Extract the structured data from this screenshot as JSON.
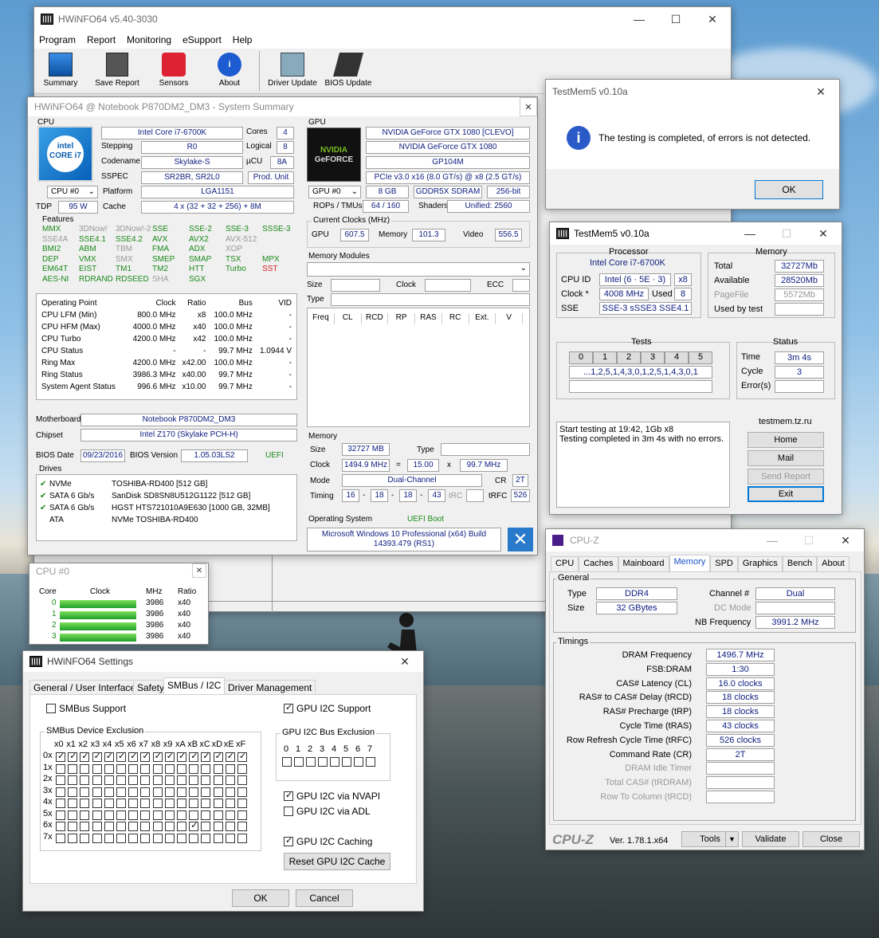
{
  "hw_main": {
    "title": "HWiNFO64 v5.40-3030",
    "menu": [
      "Program",
      "Report",
      "Monitoring",
      "eSupport",
      "Help"
    ],
    "toolbar": [
      "Summary",
      "Save Report",
      "Sensors",
      "About",
      "Driver Update",
      "BIOS Update"
    ]
  },
  "summary": {
    "title": "HWiNFO64 @ Notebook P870DM2_DM3 - System Summary",
    "cpu": {
      "section": "CPU",
      "name": "Intel Core i7-6700K",
      "cores_l": "Cores",
      "cores": "4",
      "stepping_l": "Stepping",
      "stepping": "R0",
      "logical_l": "Logical",
      "logical": "8",
      "codename_l": "Codename",
      "codename": "Skylake-S",
      "ucu_l": "µCU",
      "ucu": "8A",
      "sspec_l": "SSPEC",
      "sspec": "SR2BR, SR2L0",
      "produnit": "Prod. Unit",
      "cpu_sel": "CPU #0",
      "platform_l": "Platform",
      "platform": "LGA1151",
      "tdp_l": "TDP",
      "tdp": "95 W",
      "cache_l": "Cache",
      "cache": "4 x (32 + 32 + 256) + 8M",
      "features_l": "Features",
      "features": [
        [
          "MMX",
          "g"
        ],
        [
          "3DNow!",
          "x"
        ],
        [
          "3DNow!-2",
          "x"
        ],
        [
          "SSE",
          "g"
        ],
        [
          "SSE-2",
          "g"
        ],
        [
          "SSE-3",
          "g"
        ],
        [
          "SSSE-3",
          "g"
        ],
        [
          "SSE4A",
          "x"
        ],
        [
          "SSE4.1",
          "g"
        ],
        [
          "SSE4.2",
          "g"
        ],
        [
          "AVX",
          "g"
        ],
        [
          "AVX2",
          "g"
        ],
        [
          "AVX-512",
          "x"
        ],
        [
          "",
          ""
        ],
        [
          "BMI2",
          "g"
        ],
        [
          "ABM",
          "g"
        ],
        [
          "TBM",
          "x"
        ],
        [
          "FMA",
          "g"
        ],
        [
          "ADX",
          "g"
        ],
        [
          "XOP",
          "x"
        ],
        [
          "",
          ""
        ],
        [
          "DEP",
          "g"
        ],
        [
          "VMX",
          "g"
        ],
        [
          "SMX",
          "x"
        ],
        [
          "SMEP",
          "g"
        ],
        [
          "SMAP",
          "g"
        ],
        [
          "TSX",
          "g"
        ],
        [
          "MPX",
          "g"
        ],
        [
          "EM64T",
          "g"
        ],
        [
          "EIST",
          "g"
        ],
        [
          "TM1",
          "g"
        ],
        [
          "TM2",
          "g"
        ],
        [
          "HTT",
          "g"
        ],
        [
          "Turbo",
          "g"
        ],
        [
          "SST",
          "r"
        ],
        [
          "AES-NI",
          "g"
        ],
        [
          "RDRAND",
          "g"
        ],
        [
          "RDSEED",
          "g"
        ],
        [
          "SHA",
          "x"
        ],
        [
          "SGX",
          "g"
        ]
      ],
      "op_headers": [
        "Operating Point",
        "Clock",
        "Ratio",
        "Bus",
        "VID"
      ],
      "op_rows": [
        [
          "CPU LFM (Min)",
          "800.0 MHz",
          "x8",
          "100.0 MHz",
          "-"
        ],
        [
          "CPU HFM (Max)",
          "4000.0 MHz",
          "x40",
          "100.0 MHz",
          "-"
        ],
        [
          "CPU Turbo",
          "4200.0 MHz",
          "x42",
          "100.0 MHz",
          "-"
        ],
        [
          "CPU Status",
          "-",
          "-",
          "99.7 MHz",
          "1.0944 V"
        ],
        [
          "Ring Max",
          "4200.0 MHz",
          "x42.00",
          "100.0 MHz",
          "-"
        ],
        [
          "Ring Status",
          "3986.3 MHz",
          "x40.00",
          "99.7 MHz",
          "-"
        ],
        [
          "System Agent Status",
          "996.6 MHz",
          "x10.00",
          "99.7 MHz",
          "-"
        ]
      ]
    },
    "mb": {
      "mb_l": "Motherboard",
      "mb": "Notebook P870DM2_DM3",
      "chipset_l": "Chipset",
      "chipset": "Intel Z170 (Skylake PCH-H)",
      "biosdate_l": "BIOS Date",
      "biosdate": "09/23/2016",
      "biosver_l": "BIOS Version",
      "biosver": "1.05.03LS2",
      "uefi": "UEFI"
    },
    "drives": {
      "label": "Drives",
      "rows": [
        [
          "NVMe",
          "TOSHIBA-RD400 [512 GB]",
          true
        ],
        [
          "SATA 6 Gb/s",
          "SanDisk SD8SN8U512G1122 [512 GB]",
          true
        ],
        [
          "SATA 6 Gb/s",
          "HGST HTS721010A9E630 [1000 GB, 32MB]",
          true
        ],
        [
          "ATA",
          "NVMe TOSHIBA-RD400",
          false
        ]
      ]
    },
    "gpu": {
      "section": "GPU",
      "name1": "NVIDIA GeForce GTX 1080 [CLEVO]",
      "name2": "NVIDIA GeForce GTX 1080",
      "chip": "GP104M",
      "bus": "PCIe v3.0 x16 (8.0 GT/s) @ x8 (2.5 GT/s)",
      "gpu_sel": "GPU #0",
      "vram": "8 GB",
      "memtype": "GDDR5X SDRAM",
      "width": "256-bit",
      "rops_l": "ROPs / TMUs",
      "rops": "64 / 160",
      "shaders_l": "Shaders",
      "shaders": "Unified: 2560",
      "clocks_l": "Current Clocks (MHz)",
      "gpu_l": "GPU",
      "gpu_clk": "607.5",
      "mem_l": "Memory",
      "mem_clk": "101.3",
      "video_l": "Video",
      "video_clk": "556.5"
    },
    "modules": {
      "label": "Memory Modules",
      "size_l": "Size",
      "clock_l": "Clock",
      "ecc_l": "ECC",
      "type_l": "Type",
      "cols": [
        "Freq",
        "CL",
        "RCD",
        "RP",
        "RAS",
        "RC",
        "Ext.",
        "V"
      ]
    },
    "memory": {
      "label": "Memory",
      "size_l": "Size",
      "size": "32727 MB",
      "type_l": "Type",
      "clock_l": "Clock",
      "clock": "1494.9 MHz",
      "eq": "=",
      "mult": "15.00",
      "x": "x",
      "base": "99.7 MHz",
      "mode_l": "Mode",
      "mode": "Dual-Channel",
      "cr_l": "CR",
      "cr": "2T",
      "timing_l": "Timing",
      "t1": "16",
      "t2": "18",
      "t3": "18",
      "t4": "43",
      "trc": "tRC",
      "trfc_l": "tRFC",
      "trfc": "526"
    },
    "os": {
      "label": "Operating System",
      "boot": "UEFI Boot",
      "name": "Microsoft Windows 10 Professional (x64) Build 14393.479 (RS1)"
    }
  },
  "cpu0": {
    "title": "CPU #0",
    "headers": [
      "Core",
      "Clock",
      "MHz",
      "Ratio"
    ],
    "rows": [
      [
        "0",
        "3986",
        "x40"
      ],
      [
        "1",
        "3986",
        "x40"
      ],
      [
        "2",
        "3986",
        "x40"
      ],
      [
        "3",
        "3986",
        "x40"
      ]
    ],
    "fill": 1.0
  },
  "settings": {
    "title": "HWiNFO64 Settings",
    "tabs": [
      "General / User Interface",
      "Safety",
      "SMBus / I2C",
      "Driver Management"
    ],
    "smbus_support": "SMBus Support",
    "gpu_i2c": "GPU I2C Support",
    "excl_label": "SMBus Device Exclusion",
    "cols": [
      "x0",
      "x1",
      "x2",
      "x3",
      "x4",
      "x5",
      "x6",
      "x7",
      "x8",
      "x9",
      "xA",
      "xB",
      "xC",
      "xD",
      "xE",
      "xF"
    ],
    "rows": [
      "0x",
      "1x",
      "2x",
      "3x",
      "4x",
      "5x",
      "6x",
      "7x"
    ],
    "bus_label": "GPU I2C Bus Exclusion",
    "bus_cols": [
      "0",
      "1",
      "2",
      "3",
      "4",
      "5",
      "6",
      "7"
    ],
    "nvapi": "GPU I2C via NVAPI",
    "adl": "GPU I2C via ADL",
    "caching": "GPU I2C Caching",
    "reset": "Reset GPU I2C Cache",
    "ok": "OK",
    "cancel": "Cancel"
  },
  "tm_dialog": {
    "title": "TestMem5 v0.10a",
    "message": "The testing is completed, of errors is not detected.",
    "ok": "OK"
  },
  "tm5": {
    "title": "TestMem5 v0.10a",
    "proc_l": "Processor",
    "proc": "Intel Core i7-6700K",
    "cpuid_l": "CPU ID",
    "cpuid": "Intel (6 · 5E · 3)",
    "cpuid2": "x8",
    "clock_l": "Clock *",
    "clock": "4008 MHz",
    "used_l": "Used",
    "used": "8",
    "sse_l": "SSE",
    "sse": "SSE-3 sSSE3 SSE4.1",
    "mem_l": "Memory",
    "total_l": "Total",
    "total": "32727Mb",
    "avail_l": "Available",
    "avail": "28520Mb",
    "pagefile_l": "PageFile",
    "pagefile": "5572Mb",
    "usedby_l": "Used by test",
    "tests_l": "Tests",
    "tests_cols": [
      "0",
      "1",
      "2",
      "3",
      "4",
      "5"
    ],
    "tests_seq": "...1,2,5,1,4,3,0,1,2,5,1,4,3,0,1",
    "status_l": "Status",
    "time_l": "Time",
    "time": "3m 4s",
    "cycle_l": "Cycle",
    "cycle": "3",
    "errors_l": "Error(s)",
    "log1": "Start testing at 19:42, 1Gb x8",
    "log2": "Testing completed in 3m 4s with no errors.",
    "site": "testmem.tz.ru",
    "home": "Home",
    "mail": "Mail",
    "report": "Send Report",
    "exit": "Exit"
  },
  "cpuz": {
    "title": "CPU-Z",
    "tabs": [
      "CPU",
      "Caches",
      "Mainboard",
      "Memory",
      "SPD",
      "Graphics",
      "Bench",
      "About"
    ],
    "general_l": "General",
    "type_l": "Type",
    "type": "DDR4",
    "channel_l": "Channel #",
    "channel": "Dual",
    "size_l": "Size",
    "size": "32 GBytes",
    "dcmode_l": "DC Mode",
    "nbfreq_l": "NB Frequency",
    "nbfreq": "3991.2 MHz",
    "timings_l": "Timings",
    "timings": [
      [
        "DRAM Frequency",
        "1496.7 MHz",
        true
      ],
      [
        "FSB:DRAM",
        "1:30",
        true
      ],
      [
        "CAS# Latency (CL)",
        "16.0 clocks",
        true
      ],
      [
        "RAS# to CAS# Delay (tRCD)",
        "18 clocks",
        true
      ],
      [
        "RAS# Precharge (tRP)",
        "18 clocks",
        true
      ],
      [
        "Cycle Time (tRAS)",
        "43 clocks",
        true
      ],
      [
        "Row Refresh Cycle Time (tRFC)",
        "526 clocks",
        true
      ],
      [
        "Command Rate (CR)",
        "2T",
        true
      ],
      [
        "DRAM Idle Timer",
        "",
        false
      ],
      [
        "Total CAS# (tRDRAM)",
        "",
        false
      ],
      [
        "Row To Column (tRCD)",
        "",
        false
      ]
    ],
    "logo": "CPU-Z",
    "ver": "Ver. 1.78.1.x64",
    "tools": "Tools",
    "validate": "Validate",
    "close": "Close"
  }
}
